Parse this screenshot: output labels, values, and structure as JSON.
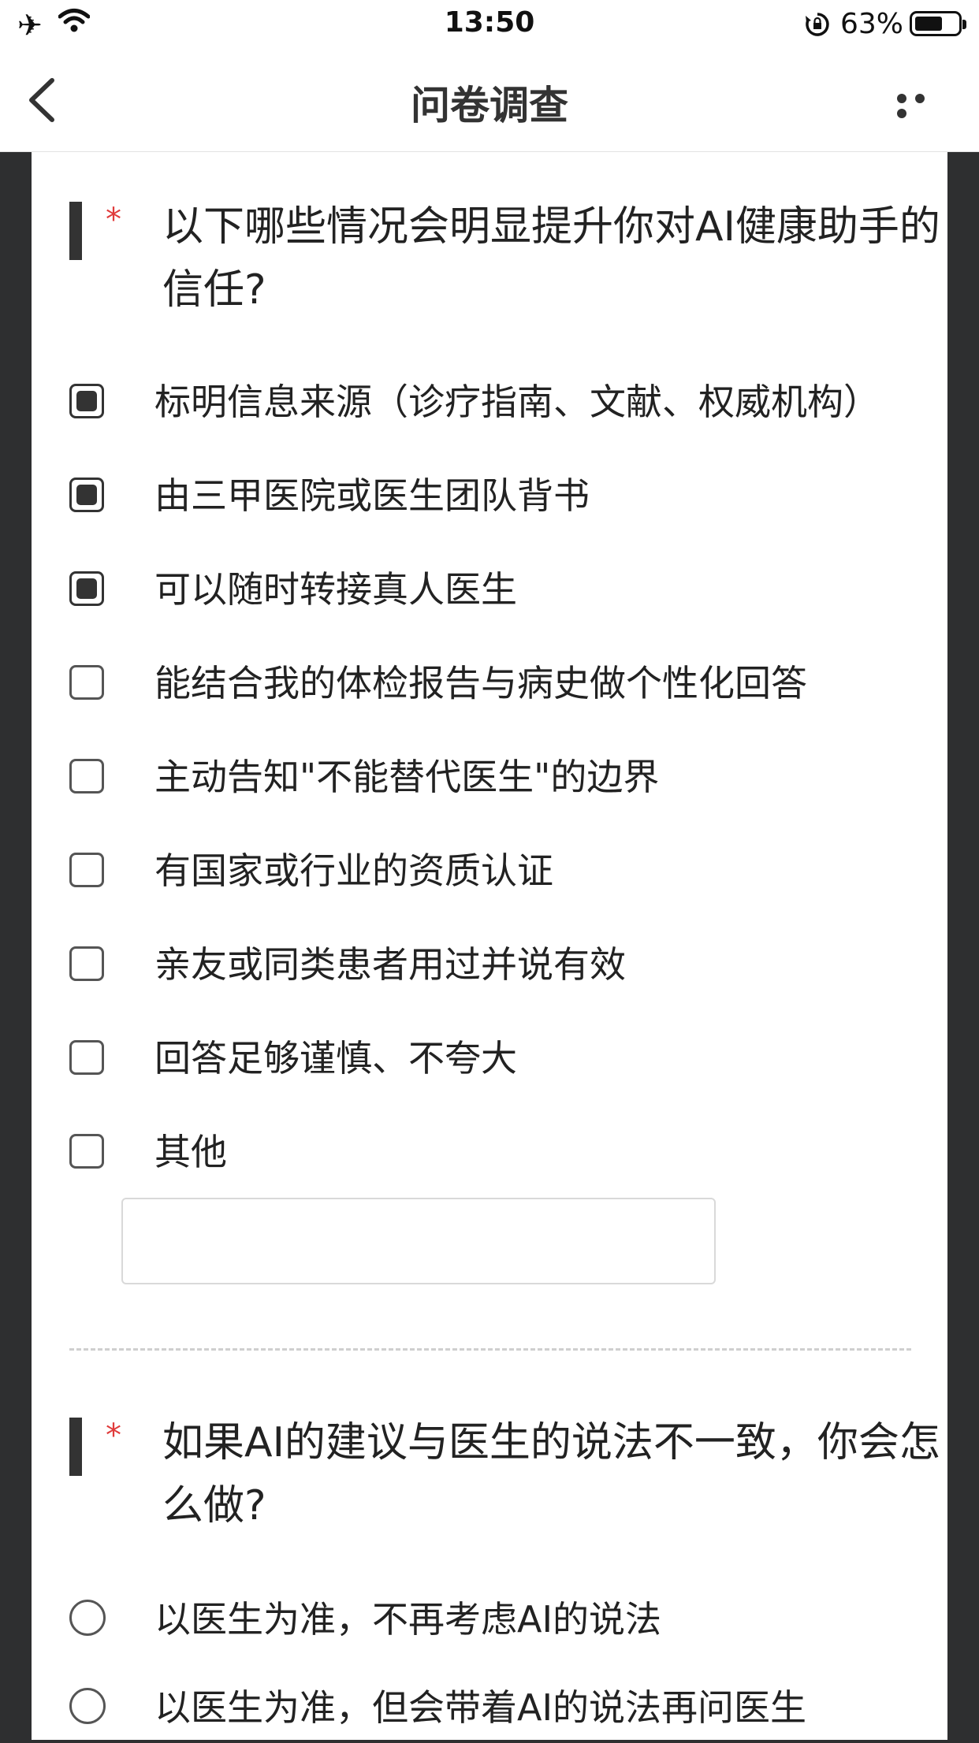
{
  "status_bar": {
    "time": "13:50",
    "battery_percent": "63%",
    "battery_level": 0.63,
    "icons": [
      "airplane-icon",
      "wifi-icon",
      "rotation-lock-icon",
      "battery-icon"
    ]
  },
  "nav": {
    "title": "问卷调查",
    "back_icon": "chevron-left-icon",
    "more_icon": "more-dots-icon"
  },
  "questions": [
    {
      "required_mark": "*",
      "title": "以下哪些情况会明显提升你对AI健康助手的信任?",
      "type": "multiple",
      "options": [
        {
          "label": "标明信息来源（诊疗指南、文献、权威机构）",
          "checked": true
        },
        {
          "label": "由三甲医院或医生团队背书",
          "checked": true
        },
        {
          "label": "可以随时转接真人医生",
          "checked": true
        },
        {
          "label": "能结合我的体检报告与病史做个性化回答",
          "checked": false
        },
        {
          "label": "主动告知\"不能替代医生\"的边界",
          "checked": false
        },
        {
          "label": "有国家或行业的资质认证",
          "checked": false
        },
        {
          "label": "亲友或同类患者用过并说有效",
          "checked": false
        },
        {
          "label": "回答足够谨慎、不夸大",
          "checked": false
        },
        {
          "label": "其他",
          "checked": false
        }
      ],
      "other_input_value": ""
    },
    {
      "required_mark": "*",
      "title": "如果AI的建议与医生的说法不一致，你会怎么做?",
      "type": "single",
      "options": [
        {
          "label": "以医生为准，不再考虑AI的说法",
          "selected": false
        },
        {
          "label": "以医生为准，但会带着AI的说法再问医生",
          "selected": false
        }
      ]
    }
  ]
}
